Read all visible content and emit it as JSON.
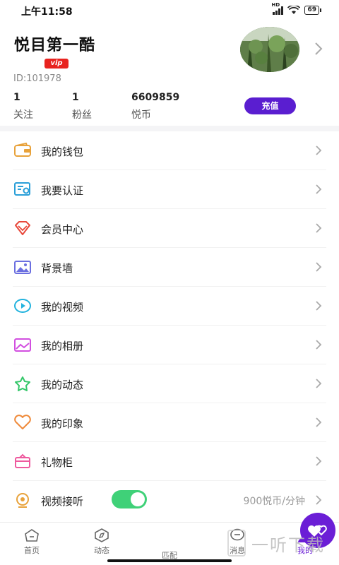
{
  "status_bar": {
    "time": "上午11:58",
    "battery": "69",
    "network": "HD"
  },
  "profile": {
    "name": "悦目第一酷",
    "vip_badge": "vip",
    "id_text": "ID:101978",
    "stats": [
      {
        "value": "1",
        "label": "关注"
      },
      {
        "value": "1",
        "label": "粉丝"
      },
      {
        "value": "6609859",
        "label": "悦币"
      }
    ],
    "recharge_label": "充值"
  },
  "menu": [
    {
      "label": "我的钱包",
      "icon": "wallet-icon",
      "color": "#e8a23b"
    },
    {
      "label": "我要认证",
      "icon": "certificate-icon",
      "color": "#2a9fd8"
    },
    {
      "label": "会员中心",
      "icon": "diamond-icon",
      "color": "#e8483b"
    },
    {
      "label": "背景墙",
      "icon": "picture-icon",
      "color": "#6b6fe0"
    },
    {
      "label": "我的视频",
      "icon": "video-play-icon",
      "color": "#23b3de"
    },
    {
      "label": "我的相册",
      "icon": "album-icon",
      "color": "#d24fe0"
    },
    {
      "label": "我的动态",
      "icon": "star-icon",
      "color": "#35c76a"
    },
    {
      "label": "我的印象",
      "icon": "heart-icon",
      "color": "#ef8a3a"
    },
    {
      "label": "礼物柜",
      "icon": "gift-cabinet-icon",
      "color": "#ee5a9e"
    },
    {
      "label": "视频接听",
      "icon": "camera-icon",
      "color": "#e8a23b",
      "toggle_on": true,
      "value": "900悦币/分钟"
    }
  ],
  "nav": [
    {
      "label": "首页",
      "icon": "home-icon"
    },
    {
      "label": "动态",
      "icon": "compass-icon"
    },
    {
      "label": "匹配",
      "icon": "hearts-icon"
    },
    {
      "label": "消息",
      "icon": "message-icon"
    },
    {
      "label": "我的",
      "icon": "profile-icon",
      "active": true
    }
  ],
  "accent_color": "#5a1ed0",
  "watermark": "一听下载"
}
